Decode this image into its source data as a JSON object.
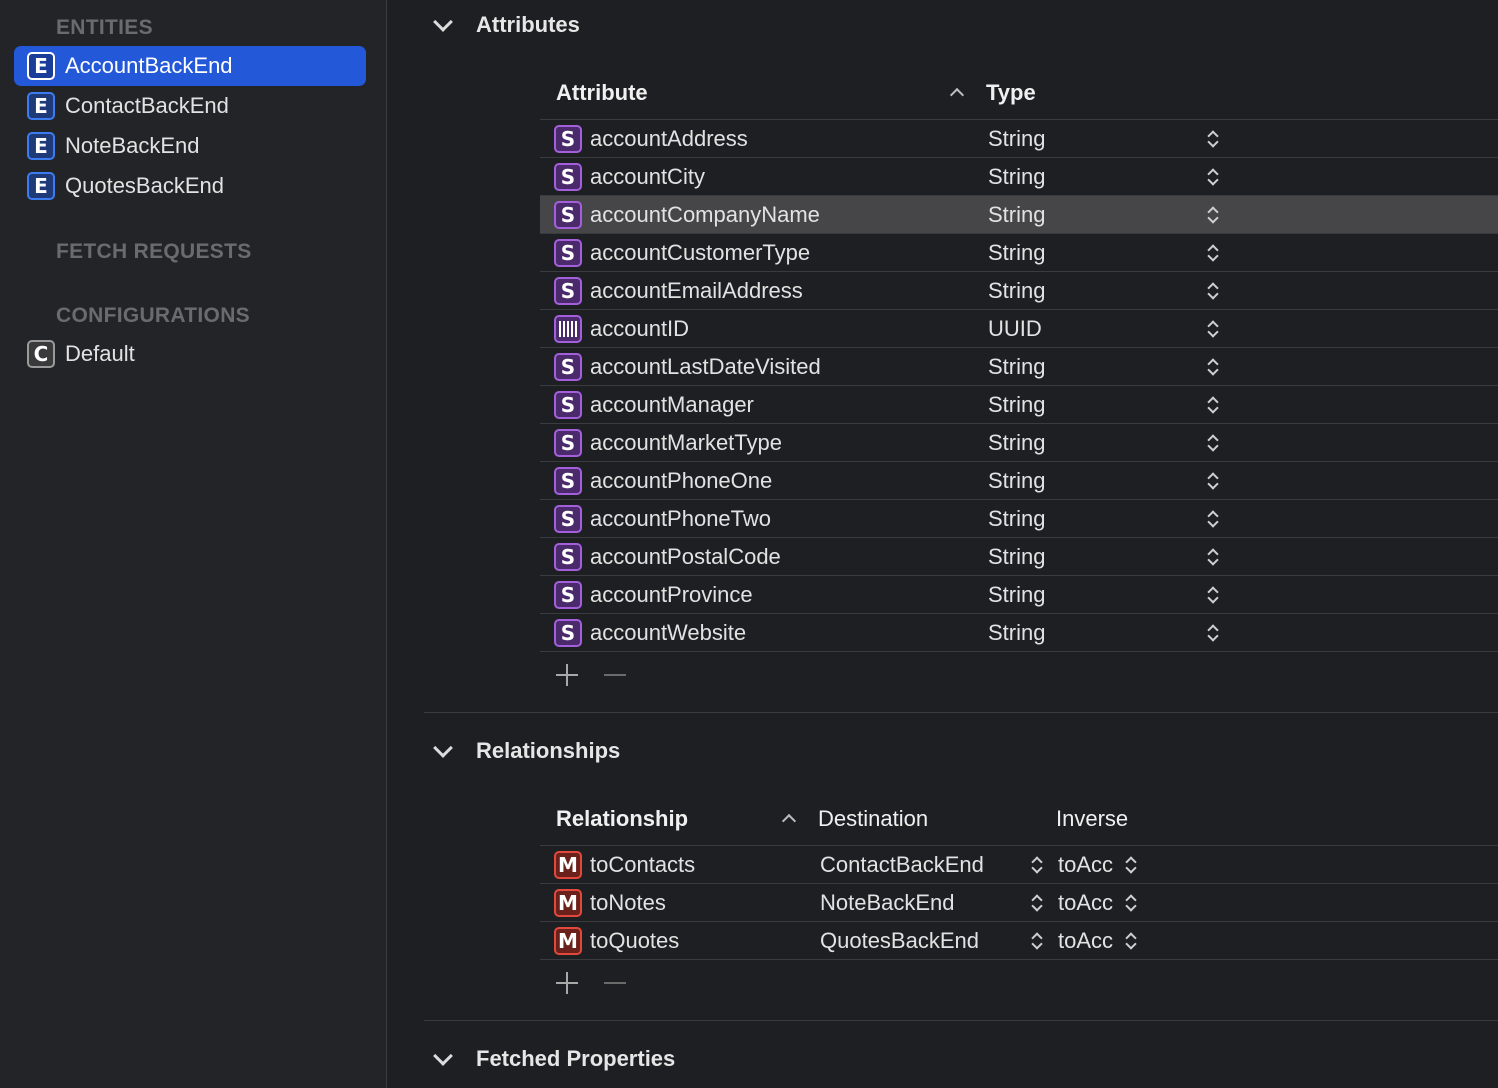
{
  "sidebar": {
    "entities_header": "ENTITIES",
    "entities": [
      {
        "badge": "E",
        "label": "AccountBackEnd",
        "selected": true
      },
      {
        "badge": "E",
        "label": "ContactBackEnd"
      },
      {
        "badge": "E",
        "label": "NoteBackEnd"
      },
      {
        "badge": "E",
        "label": "QuotesBackEnd"
      }
    ],
    "fetch_requests_header": "FETCH REQUESTS",
    "configurations_header": "CONFIGURATIONS",
    "configurations": [
      {
        "badge": "C",
        "label": "Default"
      }
    ]
  },
  "attributes": {
    "title": "Attributes",
    "col_attribute": "Attribute",
    "col_type": "Type",
    "rows": [
      {
        "badge": "S",
        "name": "accountAddress",
        "type": "String"
      },
      {
        "badge": "S",
        "name": "accountCity",
        "type": "String"
      },
      {
        "badge": "S",
        "name": "accountCompanyName",
        "type": "String"
      },
      {
        "badge": "S",
        "name": "accountCustomerType",
        "type": "String"
      },
      {
        "badge": "S",
        "name": "accountEmailAddress",
        "type": "String"
      },
      {
        "badge": "uuid-icon",
        "name": "accountID",
        "type": "UUID"
      },
      {
        "badge": "S",
        "name": "accountLastDateVisited",
        "type": "String"
      },
      {
        "badge": "S",
        "name": "accountManager",
        "type": "String"
      },
      {
        "badge": "S",
        "name": "accountMarketType",
        "type": "String"
      },
      {
        "badge": "S",
        "name": "accountPhoneOne",
        "type": "String"
      },
      {
        "badge": "S",
        "name": "accountPhoneTwo",
        "type": "String"
      },
      {
        "badge": "S",
        "name": "accountPostalCode",
        "type": "String"
      },
      {
        "badge": "S",
        "name": "accountProvince",
        "type": "String"
      },
      {
        "badge": "S",
        "name": "accountWebsite",
        "type": "String"
      }
    ]
  },
  "relationships": {
    "title": "Relationships",
    "col_relationship": "Relationship",
    "col_destination": "Destination",
    "col_inverse": "Inverse",
    "rows": [
      {
        "badge": "M",
        "name": "toContacts",
        "destination": "ContactBackEnd",
        "inverse": "toAcc"
      },
      {
        "badge": "M",
        "name": "toNotes",
        "destination": "NoteBackEnd",
        "inverse": "toAcc"
      },
      {
        "badge": "M",
        "name": "toQuotes",
        "destination": "QuotesBackEnd",
        "inverse": "toAcc"
      }
    ]
  },
  "fetched_properties": {
    "title": "Fetched Properties"
  }
}
